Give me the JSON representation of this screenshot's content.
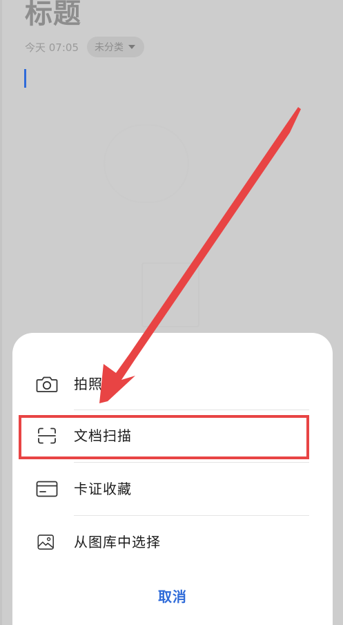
{
  "note": {
    "title": "标题",
    "date": "今天 07:05",
    "category": "未分类"
  },
  "sheet": {
    "items": [
      {
        "label": "拍照",
        "icon": "camera-icon"
      },
      {
        "label": "文档扫描",
        "icon": "document-scan-icon"
      },
      {
        "label": "卡证收藏",
        "icon": "card-icon"
      },
      {
        "label": "从图库中选择",
        "icon": "gallery-icon"
      }
    ],
    "cancel_label": "取消"
  },
  "colors": {
    "accent": "#2f6bd9",
    "annotation": "#e84444",
    "dim_background": "#cdcdcd"
  },
  "annotations": {
    "highlight_target": "document-scan",
    "arrow_icon": "annotation-arrow-icon"
  }
}
